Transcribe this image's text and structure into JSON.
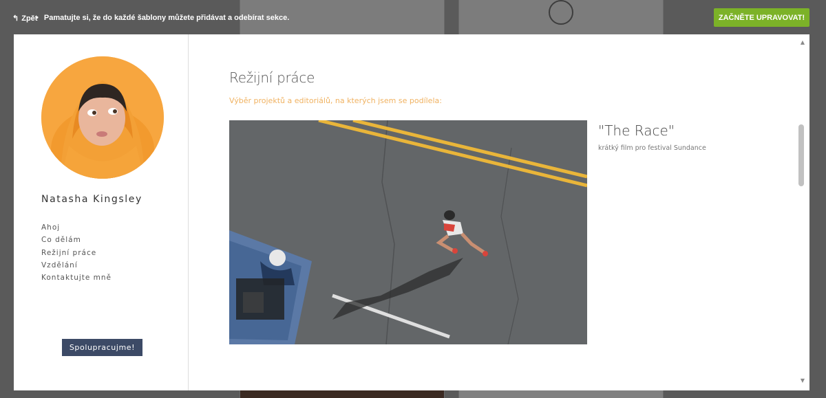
{
  "topbar": {
    "back_label": "Zpět",
    "tip_text": "Pamatujte si, že do každé šablony můžete přidávat a odebírat sekce.",
    "cta_label": "ZAČNĚTE UPRAVOVAT!"
  },
  "sidebar": {
    "name": "Natasha Kingsley",
    "nav": [
      "Ahoj",
      "Co dělám",
      "Režijní práce",
      "Vzdělání",
      "Kontaktujte mně"
    ],
    "cta_label": "Spolupracujme!"
  },
  "main": {
    "section_title": "Režijní práce",
    "section_subtitle": "Výběr projektů a editoriálů, na kterých jsem se podílela:",
    "project": {
      "title": "\"The Race\"",
      "description": "krátký film pro festival Sundance"
    }
  },
  "colors": {
    "accent_green": "#7cb228",
    "subtitle_orange": "#f0b261",
    "button_navy": "#3c4a66"
  },
  "icons": {
    "back": "back-arrow-icon",
    "scroll_up": "scroll-up-icon",
    "scroll_down": "scroll-down-icon"
  }
}
